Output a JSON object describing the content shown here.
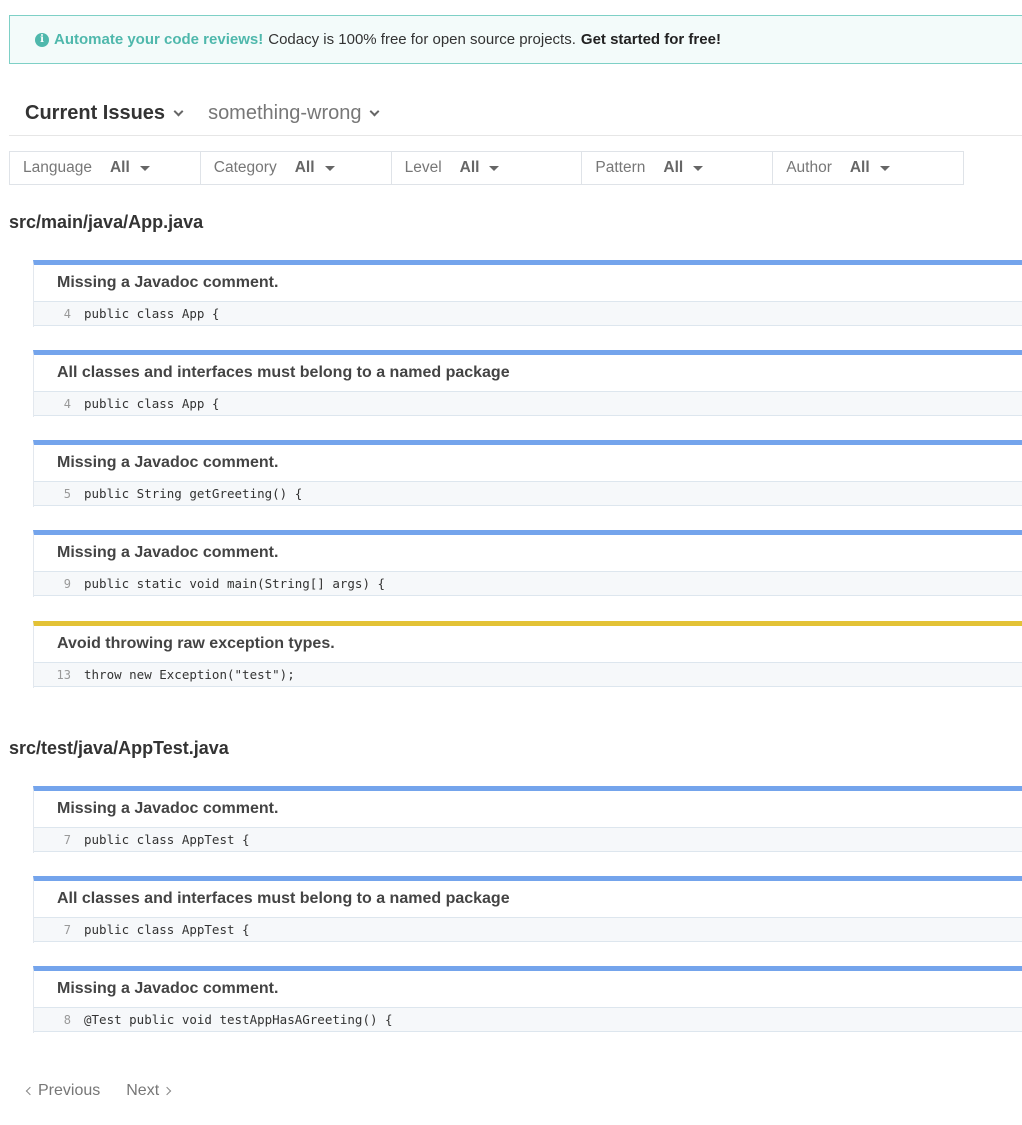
{
  "banner": {
    "icon": "info-icon",
    "lead": "Automate your code reviews!",
    "text": "Codacy is 100% free for open source projects.",
    "cta": "Get started for free!"
  },
  "header": {
    "view_label": "Current Issues",
    "repo_label": "something-wrong"
  },
  "filters": [
    {
      "label": "Language",
      "value": "All"
    },
    {
      "label": "Category",
      "value": "All"
    },
    {
      "label": "Level",
      "value": "All"
    },
    {
      "label": "Pattern",
      "value": "All"
    },
    {
      "label": "Author",
      "value": "All"
    }
  ],
  "files": [
    {
      "path": "src/main/java/App.java",
      "issues": [
        {
          "message": "Missing a Javadoc comment.",
          "line": "4",
          "code": "public class App {",
          "level": "info"
        },
        {
          "message": "All classes and interfaces must belong to a named package",
          "line": "4",
          "code": "public class App {",
          "level": "info"
        },
        {
          "message": "Missing a Javadoc comment.",
          "line": "5",
          "code": "public String getGreeting() {",
          "level": "info"
        },
        {
          "message": "Missing a Javadoc comment.",
          "line": "9",
          "code": "public static void main(String[] args) {",
          "level": "info"
        },
        {
          "message": "Avoid throwing raw exception types.",
          "line": "13",
          "code": "throw new Exception(\"test\");",
          "level": "warning"
        }
      ]
    },
    {
      "path": "src/test/java/AppTest.java",
      "issues": [
        {
          "message": "Missing a Javadoc comment.",
          "line": "7",
          "code": "public class AppTest {",
          "level": "info"
        },
        {
          "message": "All classes and interfaces must belong to a named package",
          "line": "7",
          "code": "public class AppTest {",
          "level": "info"
        },
        {
          "message": "Missing a Javadoc comment.",
          "line": "8",
          "code": "@Test public void testAppHasAGreeting() {",
          "level": "info"
        }
      ]
    }
  ],
  "pagination": {
    "previous_label": "Previous",
    "next_label": "Next"
  },
  "colors": {
    "info": "#74a4ec",
    "warning": "#e3c236",
    "accent": "#4fb8ac"
  }
}
